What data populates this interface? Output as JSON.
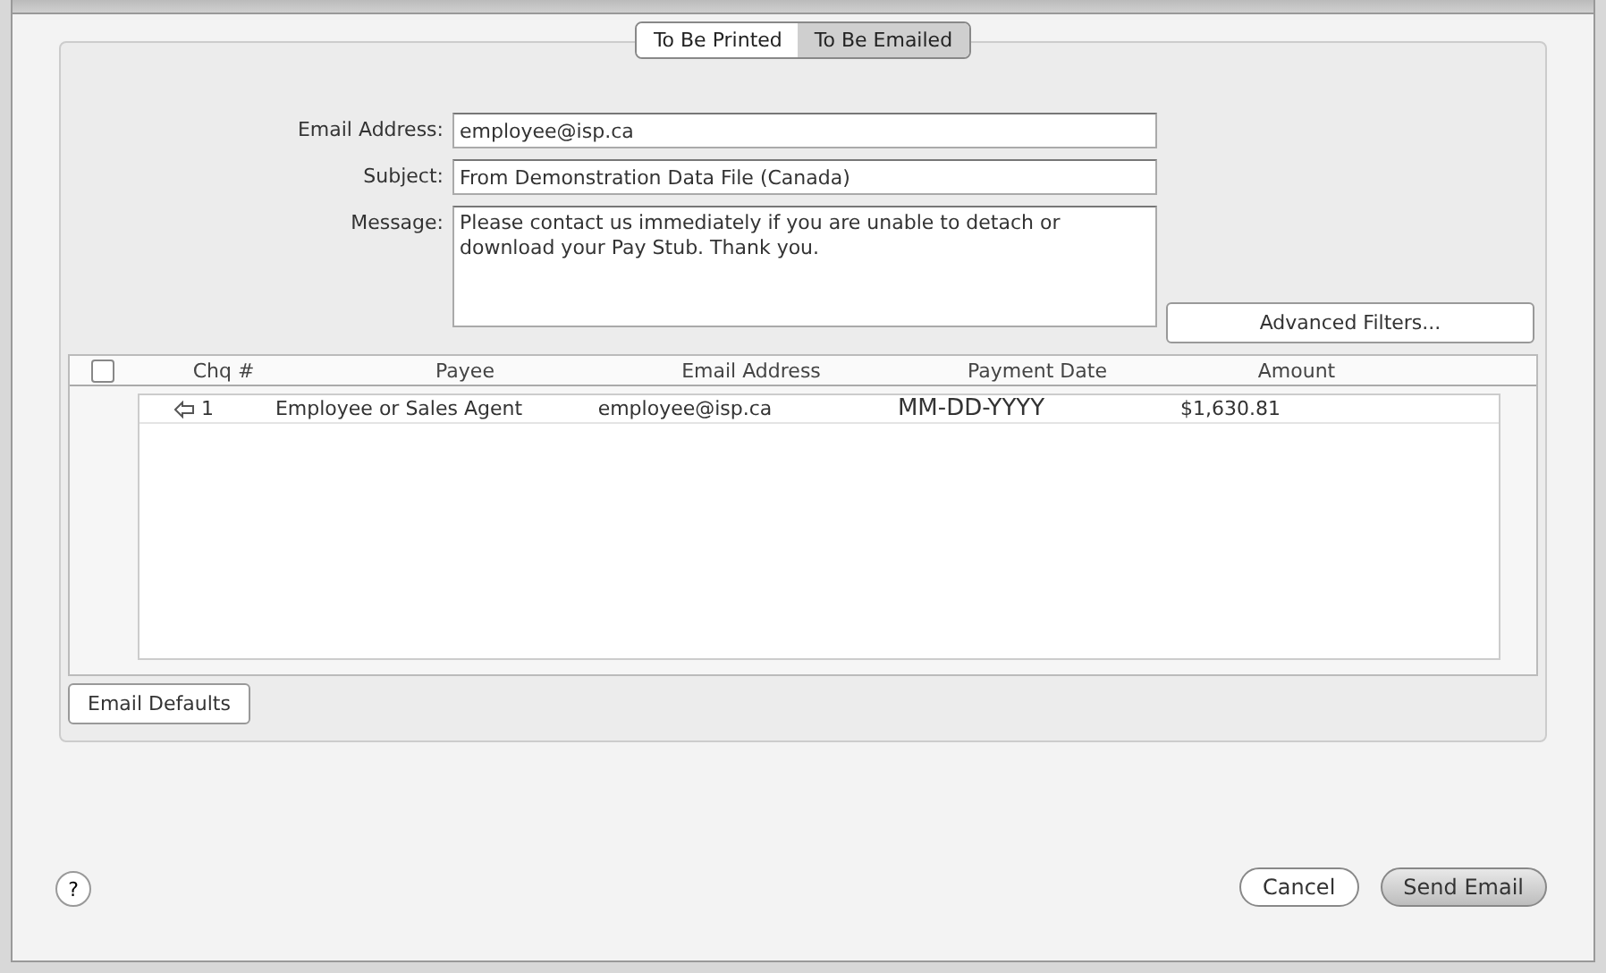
{
  "tabs": [
    {
      "label": "To Be Printed",
      "selected": false
    },
    {
      "label": "To Be Emailed",
      "selected": true
    }
  ],
  "form": {
    "email_label": "Email Address:",
    "email_value": "employee@isp.ca",
    "subject_label": "Subject:",
    "subject_value": "From Demonstration Data File (Canada)",
    "message_label": "Message:",
    "message_value": "Please contact us immediately if you are unable to detach or download your Pay Stub. Thank you."
  },
  "advanced_filters_button": "Advanced Filters...",
  "table": {
    "select_all_checked": false,
    "columns": [
      "Chq #",
      "Payee",
      "Email Address",
      "Payment Date",
      "Amount"
    ],
    "rows": [
      {
        "cells": [
          "1",
          "Employee or Sales Agent",
          "employee@isp.ca",
          "MM-DD-YYYY",
          "$1,630.81"
        ]
      }
    ]
  },
  "email_defaults_button": "Email Defaults",
  "help_button": "?",
  "buttons": [
    {
      "label": "Cancel",
      "kind": "secondary"
    },
    {
      "label": "Send Email",
      "kind": "default"
    }
  ]
}
